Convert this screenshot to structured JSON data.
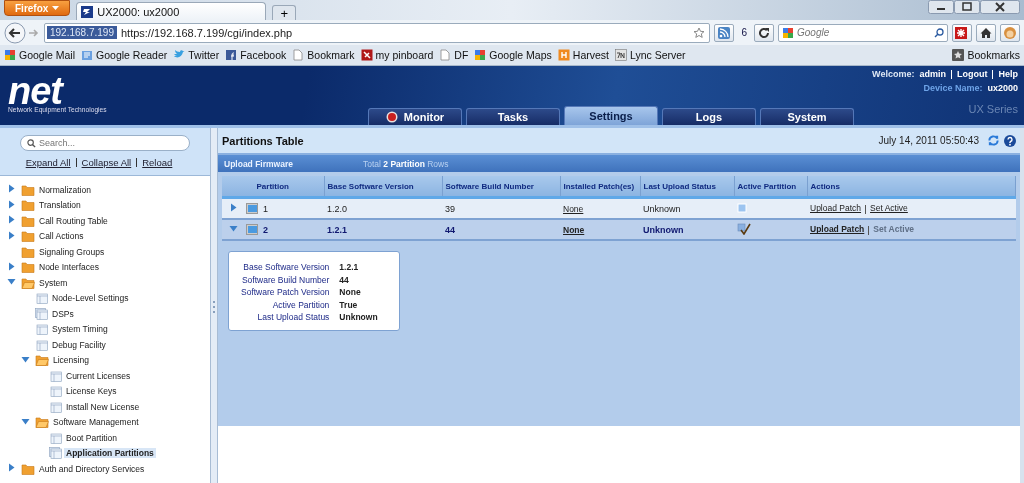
{
  "browser": {
    "menu_button": "Firefox",
    "tab_title": "UX2000: ux2000",
    "new_tab": "+",
    "site_badge": "192.168.7.199",
    "url": "https://192.168.7.199/cgi/index.php",
    "feed_count": "6",
    "search": {
      "placeholder": "Google"
    },
    "bookmarks": [
      {
        "label": "Google Mail",
        "kind": "google"
      },
      {
        "label": "Google Reader",
        "kind": "reader"
      },
      {
        "label": "Twitter",
        "kind": "bird"
      },
      {
        "label": "Facebook",
        "kind": "facebook"
      },
      {
        "label": "Bookmark",
        "kind": "page"
      },
      {
        "label": "my pinboard",
        "kind": "pin"
      },
      {
        "label": "DF",
        "kind": "page"
      },
      {
        "label": "Google Maps",
        "kind": "google"
      },
      {
        "label": "Harvest",
        "kind": "harvest"
      },
      {
        "label": "Lync Server",
        "kind": "lync"
      }
    ],
    "bookmarks_menu": "Bookmarks"
  },
  "header": {
    "logo": "net",
    "logo_subtitle": "Network Equipment Technologies",
    "welcome": "Welcome:",
    "user": "admin",
    "links": [
      "Logout",
      "Help"
    ],
    "device_label": "Device Name:",
    "device_name": "ux2000",
    "series": "UX Series",
    "nav": [
      {
        "label": "Monitor",
        "selected": false,
        "icon": true
      },
      {
        "label": "Tasks",
        "selected": false,
        "icon": false
      },
      {
        "label": "Settings",
        "selected": true,
        "icon": false
      },
      {
        "label": "Logs",
        "selected": false,
        "icon": false
      },
      {
        "label": "System",
        "selected": false,
        "icon": false
      }
    ]
  },
  "sidebar": {
    "search": {
      "placeholder": "Search..."
    },
    "links": [
      "Expand All",
      "Collapse All",
      "Reload"
    ],
    "tree": [
      {
        "label": "Normalization",
        "kind": "folder",
        "expanded": false,
        "selected": false
      },
      {
        "label": "Translation",
        "kind": "folder",
        "expanded": false,
        "selected": false
      },
      {
        "label": "Call Routing Table",
        "kind": "folder",
        "expanded": false,
        "selected": false
      },
      {
        "label": "Call Actions",
        "kind": "folder",
        "expanded": false,
        "selected": false
      },
      {
        "label": "Signaling Groups",
        "kind": "folder",
        "selected": false
      },
      {
        "label": "Node Interfaces",
        "kind": "folder",
        "expanded": false,
        "selected": false
      },
      {
        "label": "System",
        "kind": "folder",
        "expanded": true,
        "selected": false,
        "children": [
          {
            "label": "Node-Level Settings",
            "kind": "page",
            "selected": false
          },
          {
            "label": "DSPs",
            "kind": "pages",
            "selected": false
          },
          {
            "label": "System Timing",
            "kind": "page",
            "selected": false
          },
          {
            "label": "Debug Facility",
            "kind": "page",
            "selected": false
          },
          {
            "label": "Licensing",
            "kind": "folder",
            "expanded": true,
            "selected": false,
            "children": [
              {
                "label": "Current Licenses",
                "kind": "page",
                "selected": false
              },
              {
                "label": "License Keys",
                "kind": "page",
                "selected": false
              },
              {
                "label": "Install New License",
                "kind": "page",
                "selected": false
              }
            ]
          },
          {
            "label": "Software Management",
            "kind": "folder",
            "expanded": true,
            "selected": false,
            "children": [
              {
                "label": "Boot Partition",
                "kind": "page",
                "selected": false
              },
              {
                "label": "Application Partitions",
                "kind": "pages",
                "selected": true
              }
            ]
          }
        ]
      },
      {
        "label": "Auth and Directory Services",
        "kind": "folder",
        "expanded": false,
        "selected": false
      }
    ]
  },
  "main": {
    "title": "Partitions Table",
    "datetime": "July 14, 2011 05:50:43",
    "toolbar": {
      "action": "Upload Firmware",
      "summary": "Total **2 Partition** Rows"
    },
    "columns": [
      "Partition",
      "Base Software Version",
      "Software Build Number",
      "Installed Patch(es)",
      "Last Upload Status",
      "Active Partition",
      "Actions"
    ],
    "rows": [
      {
        "partition": "1",
        "expanded": false,
        "selected": false,
        "base_version": "1.2.0",
        "build": "39",
        "patches": "None",
        "upload_status": "Unknown",
        "active": false,
        "actions": [
          {
            "label": "Upload Patch",
            "disabled": false
          },
          {
            "label": "Set Active",
            "disabled": false
          }
        ]
      },
      {
        "partition": "2",
        "expanded": true,
        "selected": true,
        "base_version": "1.2.1",
        "build": "44",
        "patches": "None",
        "upload_status": "Unknown",
        "active": true,
        "actions": [
          {
            "label": "Upload Patch",
            "disabled": false
          },
          {
            "label": "Set Active",
            "disabled": true
          }
        ]
      }
    ],
    "details": [
      {
        "label": "Base Software Version",
        "value": "1.2.1"
      },
      {
        "label": "Software Build Number",
        "value": "44"
      },
      {
        "label": "Software Patch Version",
        "value": "None"
      },
      {
        "label": "Active Partition",
        "value": "True"
      },
      {
        "label": "Last Upload Status",
        "value": "Unknown"
      }
    ]
  }
}
